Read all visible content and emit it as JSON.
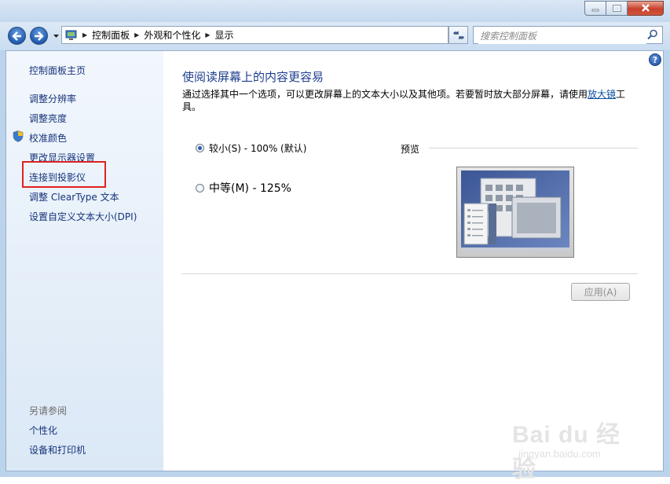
{
  "window": {
    "buttons": {
      "minimize": "minimize",
      "maximize": "maximize",
      "close": "close"
    }
  },
  "address_bar": {
    "breadcrumbs": [
      "控制面板",
      "外观和个性化",
      "显示"
    ],
    "search_placeholder": "搜索控制面板"
  },
  "sidebar": {
    "links": [
      {
        "label": "控制面板主页"
      },
      {
        "label": "调整分辨率"
      },
      {
        "label": "调整亮度"
      },
      {
        "label": "校准颜色",
        "icon": "shield-icon"
      },
      {
        "label": "更改显示器设置"
      },
      {
        "label": "连接到投影仪",
        "highlighted": true,
        "highlight_color": "#e02020"
      },
      {
        "label": "调整 ClearType 文本"
      },
      {
        "label": "设置自定义文本大小(DPI)"
      }
    ],
    "see_also_heading": "另请参阅",
    "see_also": [
      {
        "label": "个性化"
      },
      {
        "label": "设备和打印机"
      }
    ]
  },
  "main": {
    "title": "使阅读屏幕上的内容更容易",
    "description_before": "通过选择其中一个选项，可以更改屏幕上的文本大小以及其他项。若要暂时放大部分屏幕，请使用",
    "description_link": "放大镜",
    "description_after": "工具。",
    "options": [
      {
        "label": "较小(S) - 100% (默认)",
        "selected": true
      },
      {
        "label": "中等(M) - 125%",
        "selected": false
      }
    ],
    "preview_label": "预览",
    "apply_button": "应用(A)",
    "apply_enabled": false
  },
  "watermark": {
    "main": "Bai du 经验",
    "sub": "jingyan.baidu.com"
  },
  "colors": {
    "link": "#16337a",
    "title": "#1e3e8e",
    "highlight_box": "#e02020"
  }
}
